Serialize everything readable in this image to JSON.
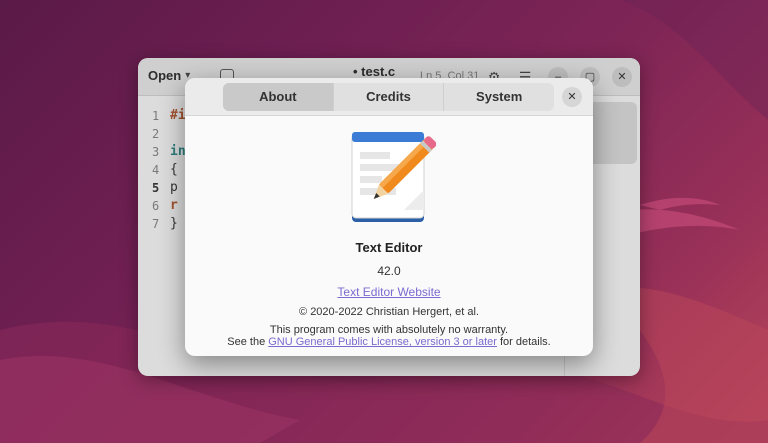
{
  "editor": {
    "open_label": "Open",
    "title": "• test.c",
    "cursor_position": "Ln 5, Col 31",
    "line_numbers": [
      "1",
      "2",
      "3",
      "4",
      "5",
      "6",
      "7"
    ],
    "code_lines": [
      "#i",
      "",
      "in",
      "{",
      " p",
      " r",
      "}"
    ]
  },
  "about": {
    "tabs": [
      {
        "label": "About",
        "active": true
      },
      {
        "label": "Credits",
        "active": false
      },
      {
        "label": "System",
        "active": false
      }
    ],
    "app_name": "Text Editor",
    "version": "42.0",
    "website_label": "Text Editor Website",
    "copyright": "© 2020-2022 Christian Hergert, et al.",
    "warranty": "This program comes with absolutely no warranty.",
    "license_prefix": "See the",
    "license_link": "GNU General Public License, version 3 or later",
    "license_suffix": "for details."
  },
  "colors": {
    "link": "#7a6bd0",
    "icon_blue": "#3a7bd5",
    "pencil_orange": "#f08a1c"
  }
}
